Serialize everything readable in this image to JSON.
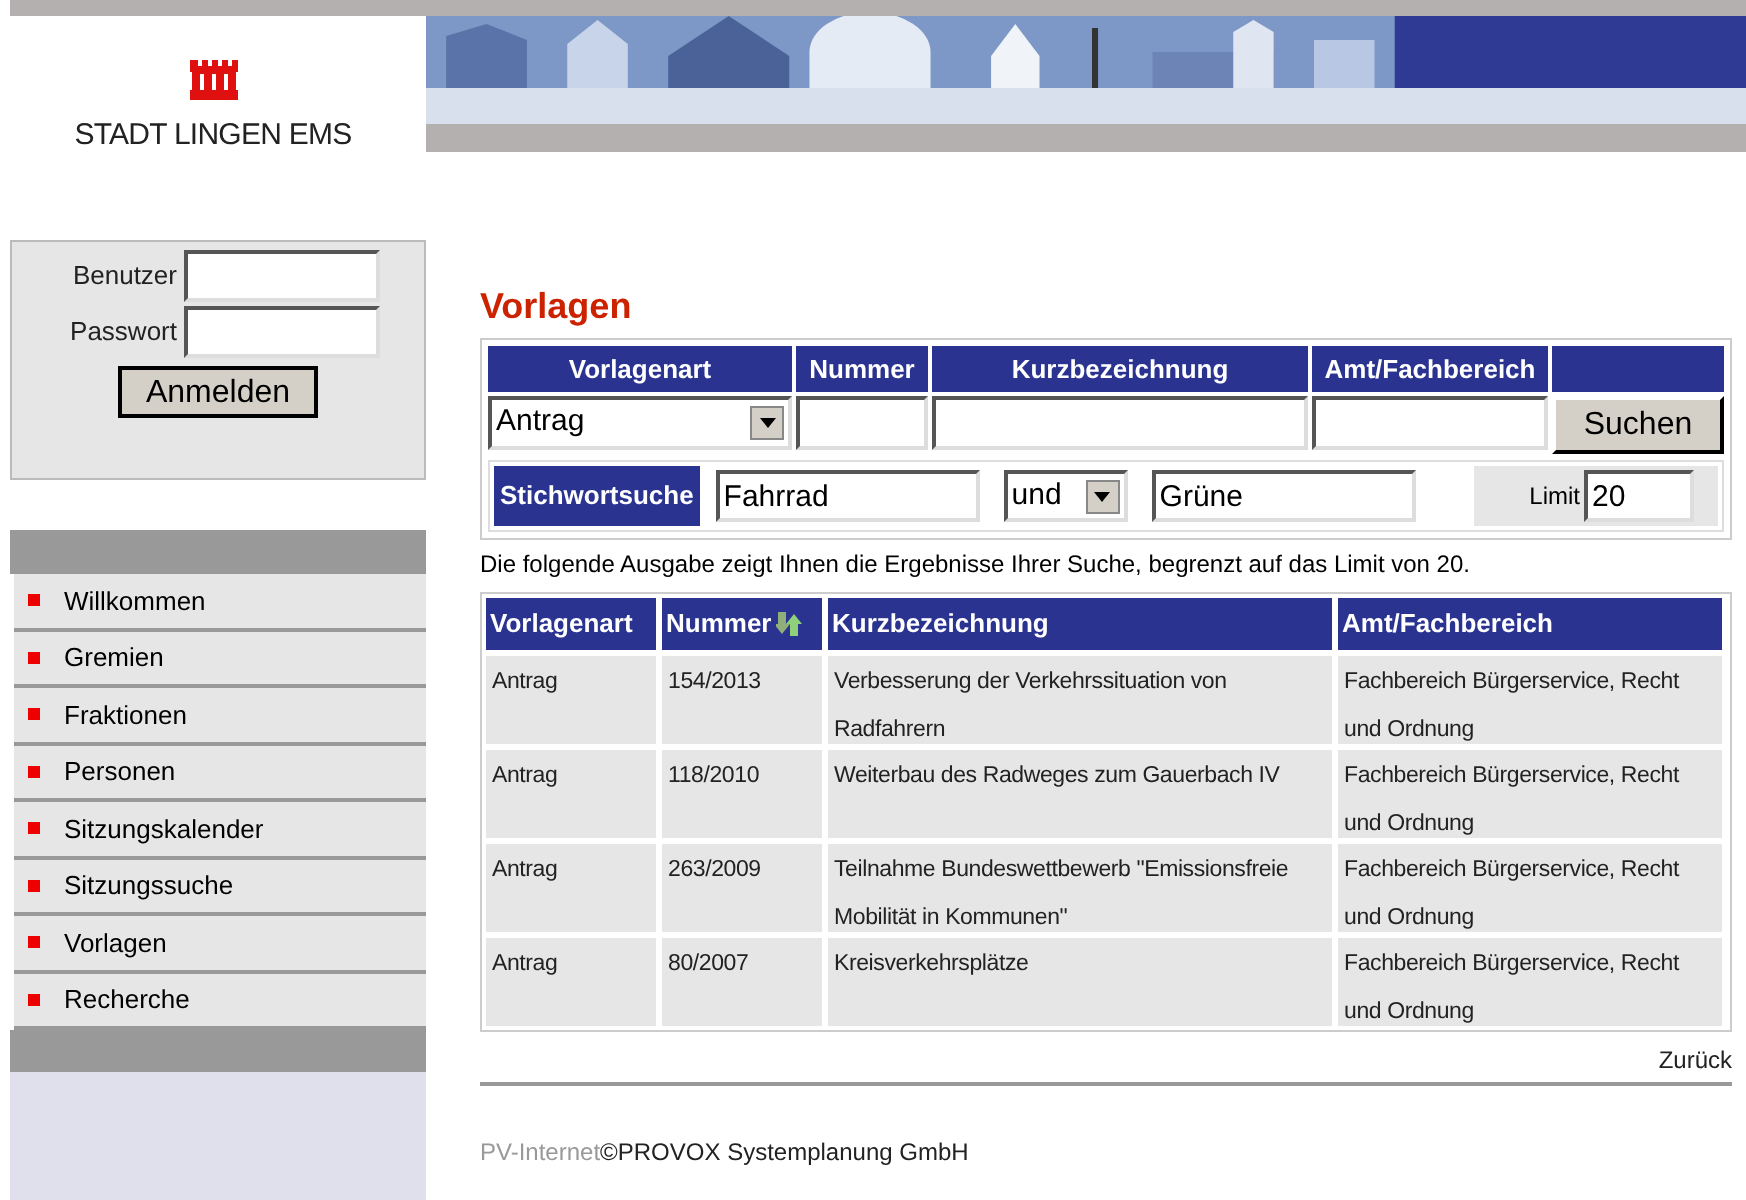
{
  "logo": {
    "text": "STADT LINGEN EMS"
  },
  "login": {
    "user_label": "Benutzer",
    "password_label": "Passwort",
    "button": "Anmelden"
  },
  "menu": [
    {
      "label": "Willkommen"
    },
    {
      "label": "Gremien"
    },
    {
      "label": "Fraktionen"
    },
    {
      "label": "Personen"
    },
    {
      "label": "Sitzungskalender"
    },
    {
      "label": "Sitzungssuche"
    },
    {
      "label": "Vorlagen"
    },
    {
      "label": "Recherche"
    }
  ],
  "title": "Vorlagen",
  "search": {
    "columns": [
      "Vorlagenart",
      "Nummer",
      "Kurzbezeichnung",
      "Amt/Fachbereich"
    ],
    "type_value": "Antrag",
    "button": "Suchen",
    "keyword_label": "Stichwortsuche",
    "keyword1": "Fahrrad",
    "operator": "und",
    "keyword2": "Grüne",
    "limit_label": "Limit",
    "limit": "20"
  },
  "info": "Die folgende Ausgabe zeigt Ihnen die Ergebnisse Ihrer Suche, begrenzt auf das Limit von 20.",
  "table": {
    "columns": [
      "Vorlagenart",
      "Nummer",
      "Kurzbezeichnung",
      "Amt/Fachbereich"
    ],
    "rows": [
      [
        "Antrag",
        "154/2013",
        "Verbesserung der Verkehrssituation von Radfahrern",
        "Fachbereich Bürgerservice, Recht und Ordnung"
      ],
      [
        "Antrag",
        "118/2010",
        "Weiterbau des Radweges zum Gauerbach IV",
        "Fachbereich Bürgerservice, Recht und Ordnung"
      ],
      [
        "Antrag",
        "263/2009",
        "Teilnahme Bundeswettbewerb \"Emissionsfreie Mobilität in Kommunen\"",
        "Fachbereich Bürgerservice, Recht und Ordnung"
      ],
      [
        "Antrag",
        "80/2007",
        "Kreisverkehrsplätze",
        "Fachbereich Bürgerservice, Recht und Ordnung"
      ]
    ]
  },
  "back_link": "Zurück",
  "footer": {
    "faded": "PV-Internet",
    "text": "©PROVOX Systemplanung GmbH"
  }
}
